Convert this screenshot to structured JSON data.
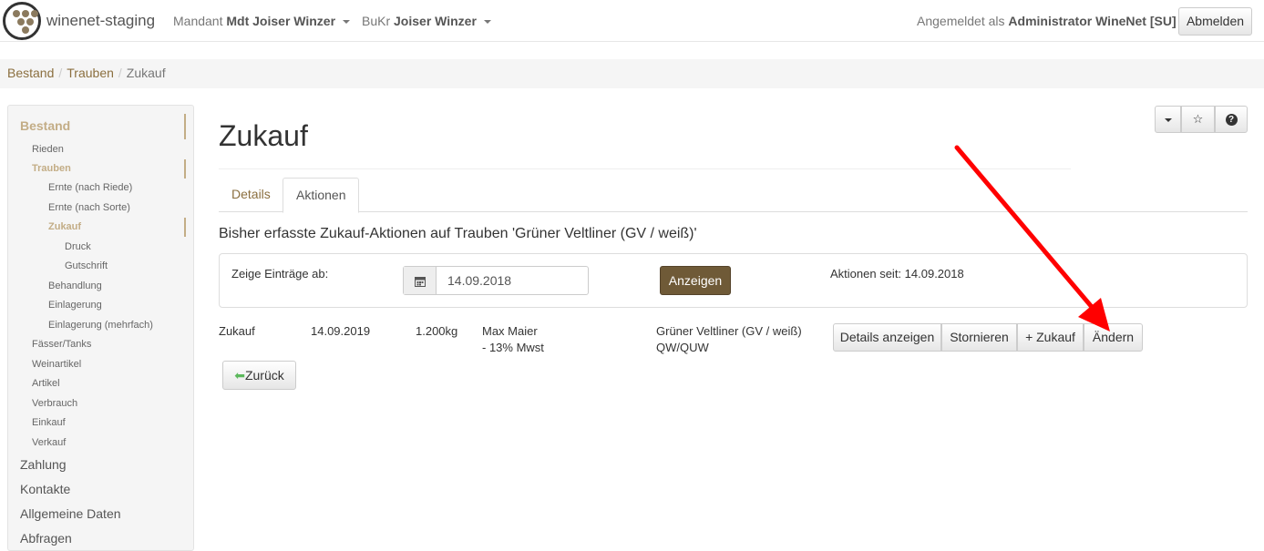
{
  "app": {
    "brand": "winenet-staging"
  },
  "navbar": {
    "mandant_label": "Mandant",
    "mandant_value": "Mdt Joiser Winzer",
    "bukr_label": "BuKr",
    "bukr_value": "Joiser Winzer",
    "login_label": "Angemeldet als",
    "login_user": "Administrator WineNet [SU]",
    "logout": "Abmelden"
  },
  "breadcrumb": [
    "Bestand",
    "Trauben",
    "Zukauf"
  ],
  "sidebar": {
    "items": [
      {
        "label": "Bestand",
        "level": 1,
        "active": true
      },
      {
        "label": "Rieden",
        "level": 2
      },
      {
        "label": "Trauben",
        "level": 2,
        "active": true
      },
      {
        "label": "Ernte (nach Riede)",
        "level": 3
      },
      {
        "label": "Ernte (nach Sorte)",
        "level": 3
      },
      {
        "label": "Zukauf",
        "level": 3,
        "active": true
      },
      {
        "label": "Druck",
        "level": 4
      },
      {
        "label": "Gutschrift",
        "level": 4
      },
      {
        "label": "Behandlung",
        "level": 3
      },
      {
        "label": "Einlagerung",
        "level": 3
      },
      {
        "label": "Einlagerung (mehrfach)",
        "level": 3
      },
      {
        "label": "Fässer/Tanks",
        "level": 2
      },
      {
        "label": "Weinartikel",
        "level": 2
      },
      {
        "label": "Artikel",
        "level": 2
      },
      {
        "label": "Verbrauch",
        "level": 2
      },
      {
        "label": "Einkauf",
        "level": 2
      },
      {
        "label": "Verkauf",
        "level": 2
      },
      {
        "label": "Zahlung",
        "level": 1
      },
      {
        "label": "Kontakte",
        "level": 1
      },
      {
        "label": "Allgemeine Daten",
        "level": 1
      },
      {
        "label": "Abfragen",
        "level": 1
      }
    ]
  },
  "main": {
    "title": "Zukauf",
    "tabs": [
      {
        "label": "Details",
        "active": false
      },
      {
        "label": "Aktionen",
        "active": true
      }
    ],
    "heading": "Bisher erfasste Zukauf-Aktionen auf Trauben 'Grüner Veltliner (GV / weiß)'",
    "filter": {
      "label": "Zeige Einträge ab:",
      "date_value": "14.09.2018",
      "show_button": "Anzeigen",
      "since_text": "Aktionen seit: 14.09.2018"
    },
    "row": {
      "type": "Zukauf",
      "date": "14.09.2019",
      "amount": "1.200kg",
      "person_line1": "Max Maier",
      "person_line2": "- 13% Mwst",
      "variety_line1": "Grüner Veltliner (GV / weiß)",
      "variety_line2": "QW/QUW"
    },
    "actions": {
      "details": "Details anzeigen",
      "cancel": "Stornieren",
      "add": "+ Zukauf",
      "change": "Ändern"
    },
    "back": "Zurück"
  },
  "icons": {
    "toolbar": [
      "caret-down-icon",
      "star-icon",
      "help-icon"
    ],
    "calendar": "calendar-icon",
    "back": "arrow-left-icon"
  },
  "colors": {
    "accent": "#8b6f3f",
    "sidebar_active": "#c3ad86",
    "primary_button": "#6f5a37",
    "annotation_arrow": "#ff0000"
  }
}
